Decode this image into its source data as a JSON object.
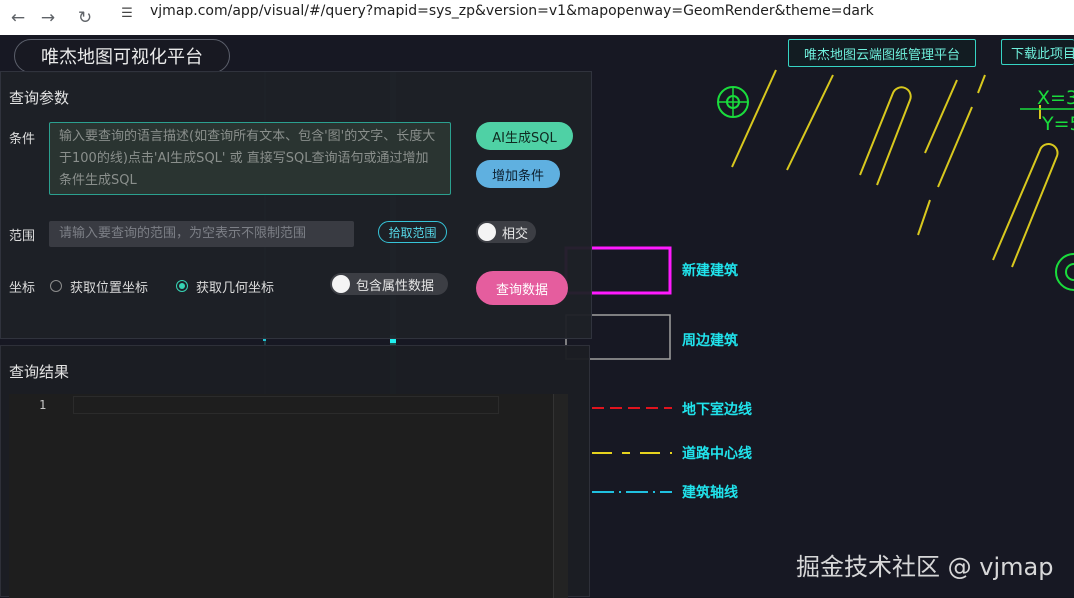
{
  "browser": {
    "url": "vjmap.com/app/visual/#/query?mapid=sys_zp&version=v1&mapopenway=GeomRender&theme=dark",
    "back_icon": "arrow-left-icon",
    "forward_icon": "arrow-right-icon",
    "reload_icon": "reload-icon",
    "site_settings_icon": "tune-icon"
  },
  "app": {
    "title": "唯杰地图可视化平台",
    "top_buttons": [
      "唯杰地图云端图纸管理平台",
      "下载此项目"
    ]
  },
  "query_panel": {
    "title": "查询参数",
    "condition_label": "条件",
    "condition_placeholder": "输入要查询的语言描述(如查询所有文本、包含'图'的文字、长度大于100的线)点击'AI生成SQL' 或 直接写SQL查询语句或通过增加条件生成SQL",
    "ai_sql_button": "AI生成SQL",
    "add_condition_button": "增加条件",
    "range_label": "范围",
    "range_placeholder": "请输入要查询的范围，为空表示不限制范围",
    "pick_range_button": "拾取范围",
    "intersect_toggle": "相交",
    "coord_label": "坐标",
    "coord_options": [
      "获取位置坐标",
      "获取几何坐标"
    ],
    "coord_selected": "获取几何坐标",
    "include_attr_toggle": "包含属性数据",
    "query_button": "查询数据"
  },
  "result_panel": {
    "title": "查询结果",
    "editor_line_number": "1"
  },
  "map_legend": {
    "items": [
      "新建建筑",
      "周边建筑",
      "地下室边线",
      "道路中心线",
      "建筑轴线"
    ],
    "coord_text": [
      "X=3",
      "Y=5"
    ]
  },
  "colors": {
    "accent": "#36d4c4",
    "ai_button": "#4fd1a5",
    "add_button": "#5fb0e0",
    "query_button": "#e55d9e",
    "legend_text": "#20e3ec",
    "new_building": "#ff1aff",
    "basement_line": "#e0141e",
    "road_line": "#e6d21e",
    "axis_line": "#20c0e0",
    "cad_yellow": "#e0d020",
    "cad_green": "#1adc3c"
  },
  "watermark": "掘金技术社区 @ vjmap"
}
